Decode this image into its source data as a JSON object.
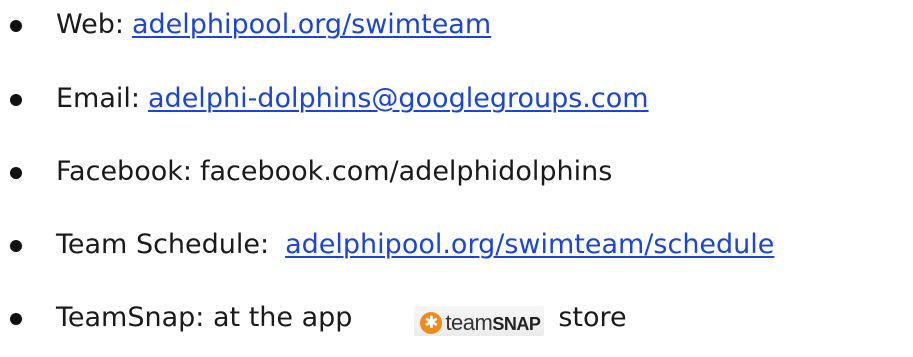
{
  "contact_list": {
    "web": {
      "label": "Web:",
      "link": "adelphipool.org/swimteam"
    },
    "email": {
      "label": "Email:",
      "link": "adelphi-dolphins@googlegroups.com"
    },
    "facebook": {
      "label": "Facebook:",
      "value": "facebook.com/adelphidolphins"
    },
    "schedule": {
      "label": "Team Schedule:",
      "link": "adelphipool.org/swimteam/schedule"
    },
    "teamsnap": {
      "label": "TeamSnap: at the app",
      "logo_text_a": "team",
      "logo_text_b": "SNAP",
      "suffix": "store",
      "logo_icon": "star-icon",
      "logo_color": "#f18a1d"
    },
    "link_color": "#1b44d8"
  }
}
